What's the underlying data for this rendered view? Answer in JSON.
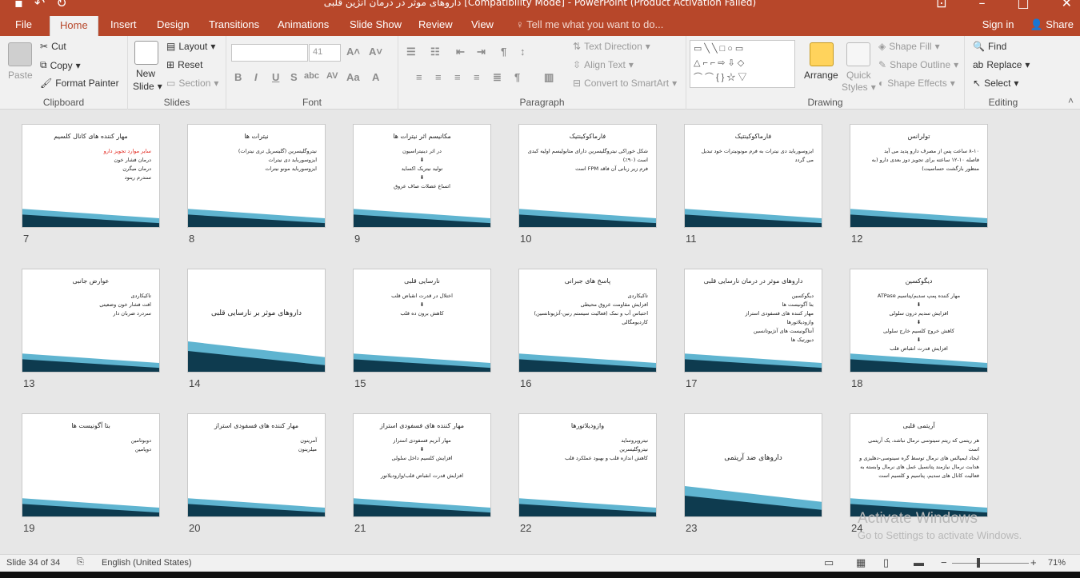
{
  "window": {
    "title": "داروهای موثر در درمان آنژین قلبی [Compatibility Mode] - PowerPoint (Product Activation Failed)"
  },
  "tabs": [
    "File",
    "Home",
    "Insert",
    "Design",
    "Transitions",
    "Animations",
    "Slide Show",
    "Review",
    "View"
  ],
  "tell_me": "Tell me what you want to do...",
  "sign_in": "Sign in",
  "share": "Share",
  "ribbon": {
    "clipboard": {
      "paste": "Paste",
      "cut": "Cut",
      "copy": "Copy",
      "format_painter": "Format Painter",
      "label": "Clipboard"
    },
    "slides": {
      "new_slide": "New",
      "new_slide2": "Slide",
      "layout": "Layout",
      "reset": "Reset",
      "section": "Section",
      "label": "Slides"
    },
    "font": {
      "font_name": "",
      "font_size": "41",
      "label": "Font"
    },
    "paragraph": {
      "text_direction": "Text Direction",
      "align_text": "Align Text",
      "convert_smartart": "Convert to SmartArt",
      "label": "Paragraph"
    },
    "drawing": {
      "arrange": "Arrange",
      "quick_styles": "Quick",
      "quick_styles2": "Styles",
      "shape_fill": "Shape Fill",
      "shape_outline": "Shape Outline",
      "shape_effects": "Shape Effects",
      "label": "Drawing"
    },
    "editing": {
      "find": "Find",
      "replace": "Replace",
      "select": "Select",
      "label": "Editing"
    }
  },
  "slides": [
    {
      "num": "7",
      "title": "مهار کننده های کانال کلسیم",
      "body": "سایر موارد تجویز دارو\nدرمان فشار خون\nدرمان میگرن\nسندرم رینود",
      "red_first": true
    },
    {
      "num": "8",
      "title": "نیترات ها",
      "body": "نیتروگلیسرین (گلیسریل تری نیترات)\nایزوسورباید دی نیترات\nایزوسورباید مونو نیترات"
    },
    {
      "num": "9",
      "title": "مکانیسم اثر نیترات ها",
      "body": "در اثر دینیتراسیون\n⬇\nتولید نیتریک اکساید\n⬇\nاتساع عضلات صاف عروق",
      "center": true
    },
    {
      "num": "10",
      "title": "فارماکوکینتیک",
      "body": "شکل خوراکی نیتروگلیسرین دارای متابولیسم اولیه کبدی است (۹۰٪)\nفرم زیر زبانی آن فاقد FPM است"
    },
    {
      "num": "11",
      "title": "فارماکوکینتیک",
      "body": "ایزوسورباید دی نیترات به فرم مونونیترات خود تبدیل می گردد"
    },
    {
      "num": "12",
      "title": "تولرانس",
      "body": "۸-۱۰ ساعت پس از مصرف دارو پدید می آید\nفاصله ۱۰-۱۲ ساعته برای تجویز دوز بعدی دارو (به منظور بازگشت حساسیت)"
    },
    {
      "num": "13",
      "title": "عوارض جانبی",
      "body": "تاکیکاردی\nافت فشار خون وضعیتی\nسردرد ضربان دار"
    },
    {
      "num": "14",
      "title": "داروهای موثر بر نارسایی قلبی",
      "section": true
    },
    {
      "num": "15",
      "title": "نارسایی قلبی",
      "body": "اختلال در قدرت انقباض قلب\n⬇\nکاهش برون ده قلب",
      "center": true
    },
    {
      "num": "16",
      "title": "پاسخ های جبرانی",
      "body": "تاکیکاردی\nافزایش مقاومت عروق محیطی\nاحتباس آب و نمک (فعالیت سیستم رنین-آنژیوتانسین)\nکاردیومگالی"
    },
    {
      "num": "17",
      "title": "داروهای موثر در درمان نارسایی قلبی",
      "body": "دیگوکسین\nبتا آگونیست ها\nمهار کننده های فسفودی استراز\nوازودیلاتورها\nآنتاگونیست های آنژیوتانسین\nدیورتیک ها"
    },
    {
      "num": "18",
      "title": "دیگوکسین",
      "body": "مهار کننده پمپ سدیم/پتاسیم ATPase\n⬇\nافزایش سدیم درون سلولی\n⬇\nکاهش خروج کلسیم خارج سلولی\n⬇\nافزایش قدرت انقباض قلب",
      "center": true
    },
    {
      "num": "19",
      "title": "بتا آگونیست ها",
      "body": "دوبوتامین\nدوپامین"
    },
    {
      "num": "20",
      "title": "مهار کننده های فسفودی استراز",
      "body": "آمرینون\nمیلرینون"
    },
    {
      "num": "21",
      "title": "مهار کننده های فسفودی استراز",
      "body": "مهار آنزیم فسفودی استراز\n⬇\nافزایش کلسیم داخل سلولی\n\nافزایش قدرت انقباض قلب/وازودیلاتور",
      "center": true
    },
    {
      "num": "22",
      "title": "وازودیلاتورها",
      "body": "نیتروپروساید\nنیتروگلیسرین\nکاهش اندازه قلب و بهبود عملکرد قلب"
    },
    {
      "num": "23",
      "title": "داروهای ضد آریتمی",
      "section": true
    },
    {
      "num": "24",
      "title": "آریتمی قلبی",
      "body": "هر ریتمی که ریتم سینوسی نرمال نباشد، یک آریتمی است\nایجاد ایمپالس های نرمال توسط گره سینوسی-دهلیزی و هدایت نرمال نیازمند پتانسیل عمل های نرمال وابسته به فعالیت کانال های سدیم، پتاسیم و کلسیم است"
    }
  ],
  "status": {
    "slide_counter": "Slide 34 of 34",
    "language": "English (United States)",
    "zoom": "71%"
  },
  "watermark": {
    "line1": "Activate Windows",
    "line2": "Go to Settings to activate Windows."
  },
  "colors": {
    "accent": "#b7472a",
    "wave_dark": "#0e3b4f",
    "wave_light": "#5fb4d0"
  }
}
